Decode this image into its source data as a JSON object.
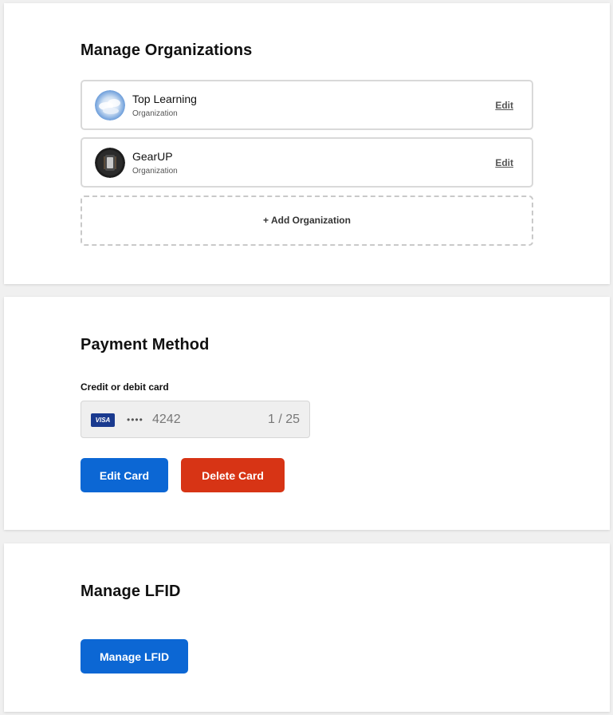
{
  "organizations": {
    "title": "Manage Organizations",
    "items": [
      {
        "name": "Top Learning",
        "type": "Organization",
        "edit_label": "Edit",
        "avatar": "cloud-sky-avatar"
      },
      {
        "name": "GearUP",
        "type": "Organization",
        "edit_label": "Edit",
        "avatar": "dark-device-avatar"
      }
    ],
    "add_label": "+ Add Organization"
  },
  "payment": {
    "title": "Payment Method",
    "field_label": "Credit or debit card",
    "card_brand": "VISA",
    "card_mask": "••••",
    "card_last4": "4242",
    "card_count": "1 / 25",
    "edit_button": "Edit Card",
    "delete_button": "Delete Card"
  },
  "lfid": {
    "title": "Manage LFID",
    "button": "Manage LFID"
  },
  "colors": {
    "primary": "#0c67d4",
    "danger": "#d73415",
    "visa": "#1a3a8f"
  }
}
